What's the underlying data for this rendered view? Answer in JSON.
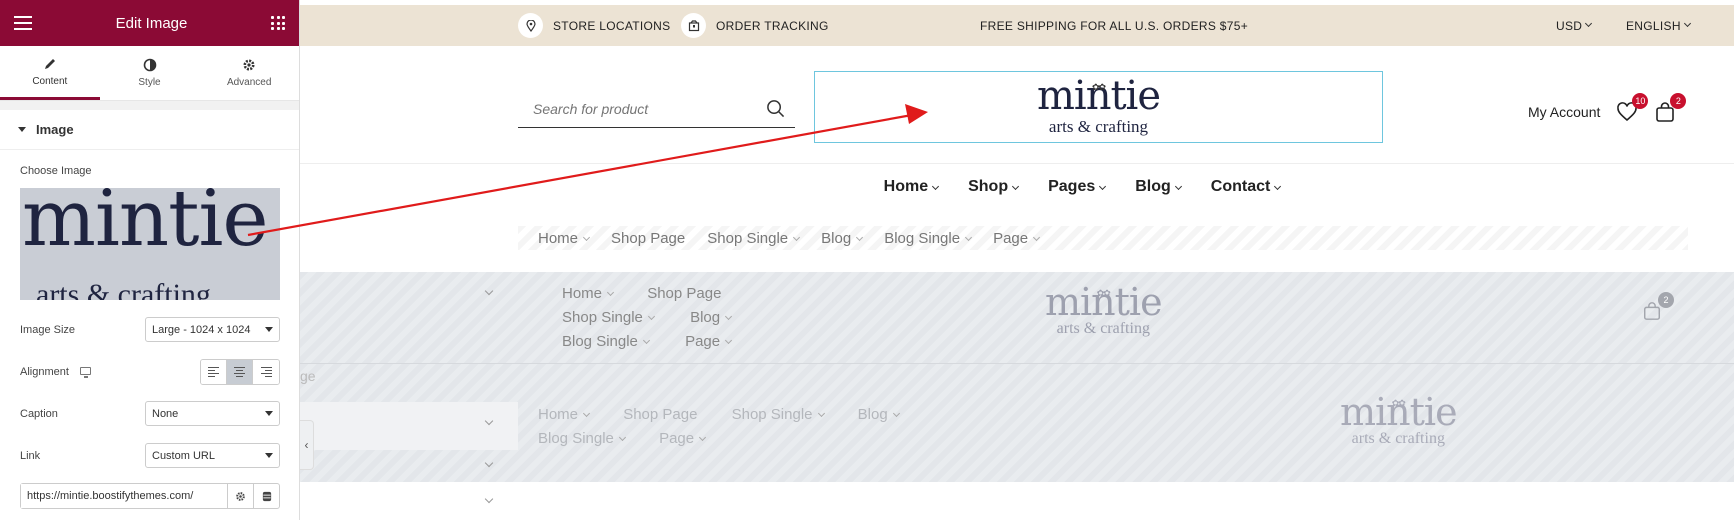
{
  "editor": {
    "title": "Edit Image",
    "tabs": [
      {
        "label": "Content"
      },
      {
        "label": "Style"
      },
      {
        "label": "Advanced"
      }
    ],
    "section_title": "Image",
    "choose_image_label": "Choose Image",
    "preview": {
      "word": "mintie",
      "tagline": "arts & crafting"
    },
    "image_size": {
      "label": "Image Size",
      "value": "Large - 1024 x 1024"
    },
    "alignment": {
      "label": "Alignment",
      "selected": "center"
    },
    "caption": {
      "label": "Caption",
      "value": "None"
    },
    "link": {
      "label": "Link",
      "value": "Custom URL"
    },
    "url": {
      "value": "https://mintie.boostifythemes.com/"
    }
  },
  "site": {
    "topbar": {
      "store_locations": "STORE LOCATIONS",
      "order_tracking": "ORDER TRACKING",
      "promo": "FREE SHIPPING FOR ALL U.S. ORDERS $75+",
      "currency": "USD",
      "language": "ENGLISH"
    },
    "search_placeholder": "Search for product",
    "logo": {
      "word": "mintie",
      "tagline": "arts & crafting"
    },
    "account_label": "My Account",
    "wishlist_count": "10",
    "cart_count": "2",
    "main_nav": [
      "Home",
      "Shop",
      "Pages",
      "Blog",
      "Contact"
    ],
    "sub_nav": [
      "Home",
      "Shop Page",
      "Shop Single",
      "Blog",
      "Blog Single",
      "Page"
    ],
    "section2_menu": [
      "Home",
      "Shop Page",
      "Shop Single",
      "Blog",
      "Blog Single",
      "Page"
    ],
    "section2_cart_count": "2",
    "section3_menu": [
      "Home",
      "Shop Page",
      "Shop Single",
      "Blog",
      "Blog Single",
      "Page"
    ],
    "faded_text": "ge"
  },
  "colors": {
    "brand": "#8b0a35",
    "accent_border": "#6ec6de",
    "badge": "#c8102e",
    "arrow": "#e01b1b"
  }
}
